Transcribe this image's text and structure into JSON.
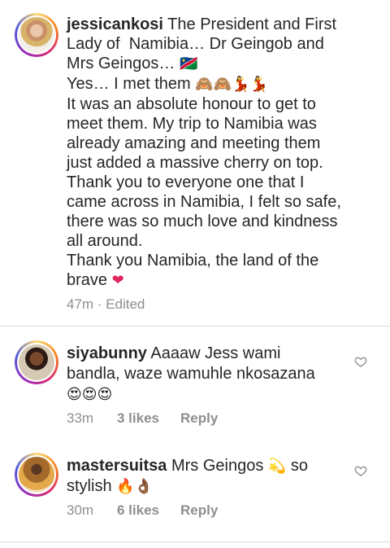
{
  "caption": {
    "username": "jessicankosi",
    "lines": [
      "The President and First",
      "Lady of  Namibia… Dr Geingob and",
      "Mrs Geingos…",
      "Yes… I met them",
      "It was an absolute honour to get to",
      "meet them. My trip to Namibia was",
      "already amazing and meeting them",
      "just added a massive cherry on top.",
      "Thank you to everyone one that I",
      "came across in Namibia, I felt so safe,",
      "there was so much love and kindness",
      "all around.",
      "Thank you Namibia, the land of the",
      "brave"
    ],
    "emoji": {
      "flag": "🇳🇦",
      "met": "🙈🙈💃💃",
      "heart": "❤"
    },
    "time": "47m",
    "edited": "Edited"
  },
  "comments": [
    {
      "username": "siyabunny",
      "text_line1": "Aaaaw Jess wami",
      "text_line2": "bandla, waze wamuhle nkosazana",
      "emoji": "😍😍😍",
      "time": "33m",
      "likes": "3 likes",
      "reply": "Reply"
    },
    {
      "username": "mastersuitsa",
      "text_a": "Mrs Geingos",
      "emoji_a": "💫",
      "text_b": "so",
      "text_line2": "stylish",
      "emoji_b": "🔥👌🏾",
      "time": "30m",
      "likes": "6 likes",
      "reply": "Reply"
    }
  ],
  "colors": {
    "text": "#262626",
    "meta": "#8e8e8e",
    "divider": "#dbdbdb"
  },
  "icons": [
    "heart-outline-icon"
  ]
}
